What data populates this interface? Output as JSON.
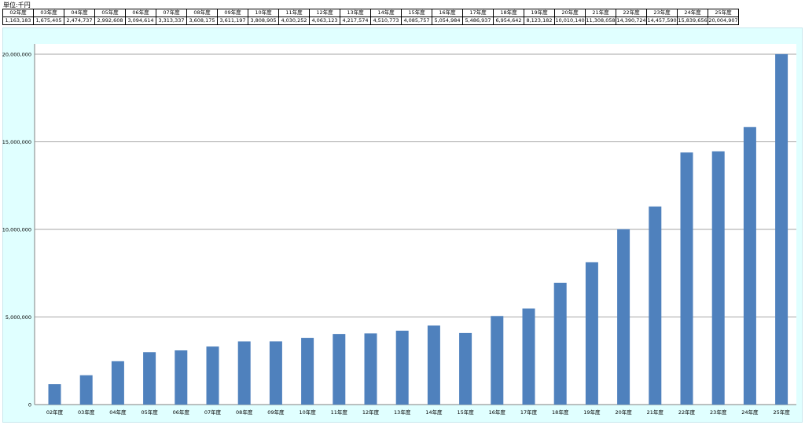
{
  "unit_label": "単位:千円",
  "table": {
    "years": [
      "02年度",
      "03年度",
      "04年度",
      "05年度",
      "06年度",
      "07年度",
      "08年度",
      "09年度",
      "10年度",
      "11年度",
      "12年度",
      "13年度",
      "14年度",
      "15年度",
      "16年度",
      "17年度",
      "18年度",
      "19年度",
      "20年度",
      "21年度",
      "22年度",
      "23年度",
      "24年度",
      "25年度"
    ],
    "values": [
      "1,163,183",
      "1,675,405",
      "2,474,737",
      "2,992,608",
      "3,094,614",
      "3,313,337",
      "3,608,175",
      "3,611,197",
      "3,808,905",
      "4,030,252",
      "4,063,123",
      "4,217,574",
      "4,510,773",
      "4,085,757",
      "5,054,984",
      "5,486,937",
      "6,954,642",
      "8,123,182",
      "10,010,140",
      "11,308,058",
      "14,390,724",
      "14,457,590",
      "15,839,656",
      "20,004,907"
    ]
  },
  "colors": {
    "bar": "#4f81bd",
    "plot_bg": "#ffffff",
    "frame_bg": "#e0ffff",
    "grid": "#a6a6a6"
  },
  "chart_data": {
    "type": "bar",
    "categories": [
      "02年度",
      "03年度",
      "04年度",
      "05年度",
      "06年度",
      "07年度",
      "08年度",
      "09年度",
      "10年度",
      "11年度",
      "12年度",
      "13年度",
      "14年度",
      "15年度",
      "16年度",
      "17年度",
      "18年度",
      "19年度",
      "20年度",
      "21年度",
      "22年度",
      "23年度",
      "24年度",
      "25年度"
    ],
    "values": [
      1163183,
      1675405,
      2474737,
      2992608,
      3094614,
      3313337,
      3608175,
      3611197,
      3808905,
      4030252,
      4063123,
      4217574,
      4510773,
      4085757,
      5054984,
      5486937,
      6954642,
      8123182,
      10010140,
      11308058,
      14390724,
      14457590,
      15839656,
      20004907
    ],
    "ylim": [
      0,
      20000000
    ],
    "yticks": [
      0,
      5000000,
      10000000,
      15000000,
      20000000
    ],
    "ytick_labels": [
      "0",
      "5,000,000",
      "10,000,000",
      "15,000,000",
      "20,000,000"
    ],
    "grid": true
  }
}
